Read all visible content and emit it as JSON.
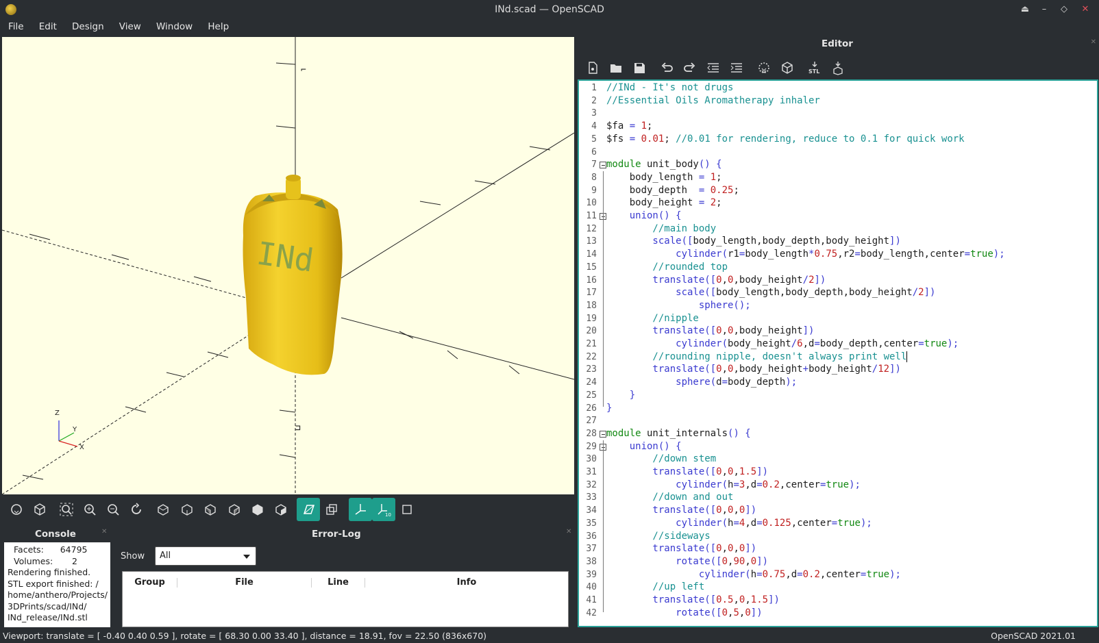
{
  "window": {
    "title": "INd.scad — OpenSCAD"
  },
  "menu": [
    "File",
    "Edit",
    "Design",
    "View",
    "Window",
    "Help"
  ],
  "viewport": {
    "model_label": "INd"
  },
  "console": {
    "title": "Console",
    "lines": [
      "Facets:      64795",
      "Volumes:       2",
      "Rendering finished.",
      "STL export finished: /",
      "home/anthero/Projects/",
      "3DPrints/scad/INd/",
      "INd_release/INd.stl"
    ]
  },
  "errorlog": {
    "title": "Error-Log",
    "show_label": "Show",
    "show_value": "All",
    "columns": [
      "Group",
      "File",
      "Line",
      "Info"
    ]
  },
  "editor": {
    "title": "Editor",
    "lines": [
      [
        [
          "cm",
          "//INd - It's not drugs"
        ]
      ],
      [
        [
          "cm",
          "//Essential Oils Aromatherapy inhaler"
        ]
      ],
      [],
      [
        [
          "var",
          "$fa "
        ],
        [
          "kw",
          "="
        ],
        [
          "num",
          " 1"
        ],
        [
          "var",
          ";"
        ]
      ],
      [
        [
          "var",
          "$fs "
        ],
        [
          "kw",
          "="
        ],
        [
          "num",
          " 0.01"
        ],
        [
          "var",
          "; "
        ],
        [
          "cm",
          "//0.01 for rendering, reduce to 0.1 for quick work"
        ]
      ],
      [],
      [
        [
          "tru",
          "module"
        ],
        [
          "var",
          " unit_body"
        ],
        [
          "kw",
          "() {"
        ]
      ],
      [
        [
          "var",
          "    body_length "
        ],
        [
          "kw",
          "="
        ],
        [
          "num",
          " 1"
        ],
        [
          "var",
          ";"
        ]
      ],
      [
        [
          "var",
          "    body_depth  "
        ],
        [
          "kw",
          "="
        ],
        [
          "num",
          " 0.25"
        ],
        [
          "var",
          ";"
        ]
      ],
      [
        [
          "var",
          "    body_height "
        ],
        [
          "kw",
          "="
        ],
        [
          "num",
          " 2"
        ],
        [
          "var",
          ";"
        ]
      ],
      [
        [
          "kw",
          "    union() {"
        ]
      ],
      [
        [
          "cm",
          "        //main body"
        ]
      ],
      [
        [
          "kw",
          "        scale(["
        ],
        [
          "var",
          "body_length,body_depth,body_height"
        ],
        [
          "kw",
          "])"
        ]
      ],
      [
        [
          "kw",
          "            cylinder("
        ],
        [
          "var",
          "r1"
        ],
        [
          "kw",
          "="
        ],
        [
          "var",
          "body_length"
        ],
        [
          "kw",
          "*"
        ],
        [
          "num",
          "0.75"
        ],
        [
          "var",
          ",r2"
        ],
        [
          "kw",
          "="
        ],
        [
          "var",
          "body_length,center"
        ],
        [
          "kw",
          "="
        ],
        [
          "tru",
          "true"
        ],
        [
          "kw",
          ");"
        ]
      ],
      [
        [
          "cm",
          "        //rounded top"
        ]
      ],
      [
        [
          "kw",
          "        translate(["
        ],
        [
          "num",
          "0"
        ],
        [
          "var",
          ","
        ],
        [
          "num",
          "0"
        ],
        [
          "var",
          ",body_height"
        ],
        [
          "kw",
          "/"
        ],
        [
          "num",
          "2"
        ],
        [
          "kw",
          "])"
        ]
      ],
      [
        [
          "kw",
          "            scale(["
        ],
        [
          "var",
          "body_length,body_depth,body_height"
        ],
        [
          "kw",
          "/"
        ],
        [
          "num",
          "2"
        ],
        [
          "kw",
          "])"
        ]
      ],
      [
        [
          "kw",
          "                sphere();"
        ]
      ],
      [
        [
          "cm",
          "        //nipple"
        ]
      ],
      [
        [
          "kw",
          "        translate(["
        ],
        [
          "num",
          "0"
        ],
        [
          "var",
          ","
        ],
        [
          "num",
          "0"
        ],
        [
          "var",
          ",body_height"
        ],
        [
          "kw",
          "])"
        ]
      ],
      [
        [
          "kw",
          "            cylinder("
        ],
        [
          "var",
          "body_height"
        ],
        [
          "kw",
          "/"
        ],
        [
          "num",
          "6"
        ],
        [
          "var",
          ",d"
        ],
        [
          "kw",
          "="
        ],
        [
          "var",
          "body_depth,center"
        ],
        [
          "kw",
          "="
        ],
        [
          "tru",
          "true"
        ],
        [
          "kw",
          ");"
        ]
      ],
      [
        [
          "cm",
          "        //rounding nipple, doesn't always print well"
        ],
        [
          "cursor",
          ""
        ]
      ],
      [
        [
          "kw",
          "        translate(["
        ],
        [
          "num",
          "0"
        ],
        [
          "var",
          ","
        ],
        [
          "num",
          "0"
        ],
        [
          "var",
          ",body_height"
        ],
        [
          "kw",
          "+"
        ],
        [
          "var",
          "body_height"
        ],
        [
          "kw",
          "/"
        ],
        [
          "num",
          "12"
        ],
        [
          "kw",
          "])"
        ]
      ],
      [
        [
          "kw",
          "            sphere("
        ],
        [
          "var",
          "d"
        ],
        [
          "kw",
          "="
        ],
        [
          "var",
          "body_depth"
        ],
        [
          "kw",
          ");"
        ]
      ],
      [
        [
          "kw",
          "    }"
        ]
      ],
      [
        [
          "kw",
          "}"
        ]
      ],
      [],
      [
        [
          "tru",
          "module"
        ],
        [
          "var",
          " unit_internals"
        ],
        [
          "kw",
          "() {"
        ]
      ],
      [
        [
          "kw",
          "    union() {"
        ]
      ],
      [
        [
          "cm",
          "        //down stem"
        ]
      ],
      [
        [
          "kw",
          "        translate(["
        ],
        [
          "num",
          "0"
        ],
        [
          "var",
          ","
        ],
        [
          "num",
          "0"
        ],
        [
          "var",
          ","
        ],
        [
          "num",
          "1.5"
        ],
        [
          "kw",
          "])"
        ]
      ],
      [
        [
          "kw",
          "            cylinder("
        ],
        [
          "var",
          "h"
        ],
        [
          "kw",
          "="
        ],
        [
          "num",
          "3"
        ],
        [
          "var",
          ",d"
        ],
        [
          "kw",
          "="
        ],
        [
          "num",
          "0.2"
        ],
        [
          "var",
          ",center"
        ],
        [
          "kw",
          "="
        ],
        [
          "tru",
          "true"
        ],
        [
          "kw",
          ");"
        ]
      ],
      [
        [
          "cm",
          "        //down and out"
        ]
      ],
      [
        [
          "kw",
          "        translate(["
        ],
        [
          "num",
          "0"
        ],
        [
          "var",
          ","
        ],
        [
          "num",
          "0"
        ],
        [
          "var",
          ","
        ],
        [
          "num",
          "0"
        ],
        [
          "kw",
          "])"
        ]
      ],
      [
        [
          "kw",
          "            cylinder("
        ],
        [
          "var",
          "h"
        ],
        [
          "kw",
          "="
        ],
        [
          "num",
          "4"
        ],
        [
          "var",
          ",d"
        ],
        [
          "kw",
          "="
        ],
        [
          "num",
          "0.125"
        ],
        [
          "var",
          ",center"
        ],
        [
          "kw",
          "="
        ],
        [
          "tru",
          "true"
        ],
        [
          "kw",
          ");"
        ]
      ],
      [
        [
          "cm",
          "        //sideways"
        ]
      ],
      [
        [
          "kw",
          "        translate(["
        ],
        [
          "num",
          "0"
        ],
        [
          "var",
          ","
        ],
        [
          "num",
          "0"
        ],
        [
          "var",
          ","
        ],
        [
          "num",
          "0"
        ],
        [
          "kw",
          "])"
        ]
      ],
      [
        [
          "kw",
          "            rotate(["
        ],
        [
          "num",
          "0"
        ],
        [
          "var",
          ","
        ],
        [
          "num",
          "90"
        ],
        [
          "var",
          ","
        ],
        [
          "num",
          "0"
        ],
        [
          "kw",
          "])"
        ]
      ],
      [
        [
          "kw",
          "                cylinder("
        ],
        [
          "var",
          "h"
        ],
        [
          "kw",
          "="
        ],
        [
          "num",
          "0.75"
        ],
        [
          "var",
          ",d"
        ],
        [
          "kw",
          "="
        ],
        [
          "num",
          "0.2"
        ],
        [
          "var",
          ",center"
        ],
        [
          "kw",
          "="
        ],
        [
          "tru",
          "true"
        ],
        [
          "kw",
          ");"
        ]
      ],
      [
        [
          "cm",
          "        //up left"
        ]
      ],
      [
        [
          "kw",
          "        translate(["
        ],
        [
          "num",
          "0.5"
        ],
        [
          "var",
          ","
        ],
        [
          "num",
          "0"
        ],
        [
          "var",
          ","
        ],
        [
          "num",
          "1.5"
        ],
        [
          "kw",
          "])"
        ]
      ],
      [
        [
          "kw",
          "            rotate(["
        ],
        [
          "num",
          "0"
        ],
        [
          "var",
          ","
        ],
        [
          "num",
          "5"
        ],
        [
          "var",
          ","
        ],
        [
          "num",
          "0"
        ],
        [
          "kw",
          "])"
        ]
      ]
    ],
    "fold_lines": [
      7,
      11,
      28,
      29
    ]
  },
  "status": {
    "viewport": "Viewport: translate = [ -0.40 0.40 0.59 ], rotate = [ 68.30 0.00 33.40 ], distance = 18.91, fov = 22.50 (836x670)",
    "version": "OpenSCAD 2021.01"
  },
  "colors": {
    "accent": "#1e9e8c",
    "model": "#e8c21c",
    "viewport_bg": "#ffffe5",
    "editor_border": "#2aa198"
  }
}
